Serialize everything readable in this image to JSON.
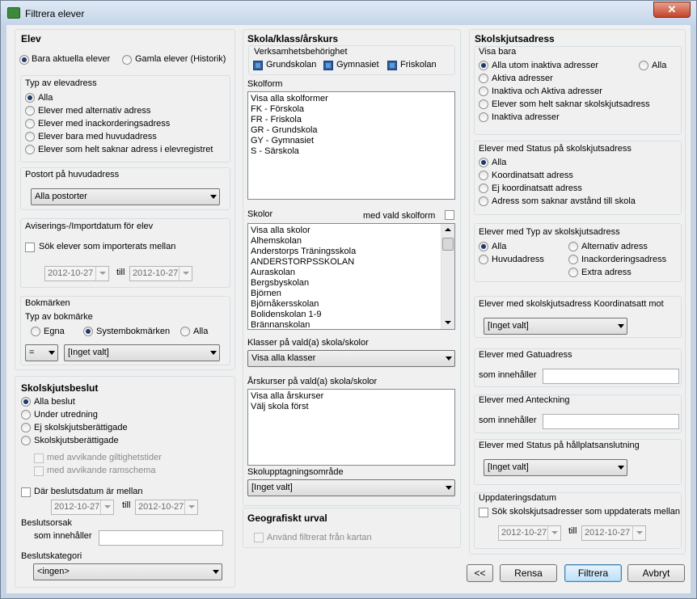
{
  "window": {
    "title": "Filtrera elever",
    "close": "✕"
  },
  "elev": {
    "header": "Elev",
    "r_aktuella": "Bara aktuella elever",
    "r_gamla": "Gamla elever (Historik)",
    "typ_header": "Typ av elevadress",
    "typ": [
      "Alla",
      "Elever med alternativ adress",
      "Elever med inackorderingsadress",
      "Elever bara med huvudadress",
      "Elever som helt saknar adress i elevregistret"
    ],
    "postort_header": "Postort på huvudadress",
    "postort_value": "Alla postorter",
    "avis_header": "Aviserings-/Importdatum för elev",
    "avis_cb": "Sök elever som importerats mellan",
    "date_from": "2012-10-27",
    "till": "till",
    "date_to": "2012-10-27",
    "bok_header": "Bokmärken",
    "bok_typ": "Typ av bokmärke",
    "bok_opts": [
      "Egna",
      "Systembokmärken",
      "Alla"
    ],
    "bok_op": "=",
    "bok_value": "[Inget valt]"
  },
  "beslut": {
    "header": "Skolskjutsbeslut",
    "opts": [
      "Alla beslut",
      "Under utredning",
      "Ej skolskjutsberättigade",
      "Skolskjutsberättigade"
    ],
    "sub1": "med avvikande giltighetstider",
    "sub2": "med avvikande ramschema",
    "date_cb": "Där beslutsdatum är mellan",
    "date_from": "2012-10-27",
    "till": "till",
    "date_to": "2012-10-27",
    "orsak": "Beslutsorsak",
    "innehaller": "som innehåller",
    "kategori": "Beslutskategori",
    "kategori_value": "<ingen>"
  },
  "skola": {
    "header": "Skola/klass/årskurs",
    "verk_header": "Verksamhetsbehörighet",
    "verk": [
      "Grundskolan",
      "Gymnasiet",
      "Friskolan"
    ],
    "skolform_label": "Skolform",
    "skolform": [
      "Visa alla skolformer",
      "FK - Förskola",
      "FR - Friskola",
      "GR - Grundskola",
      "GY - Gymnasiet",
      "S - Särskola"
    ],
    "skolor_label": "Skolor",
    "med_vald": "med vald skolform",
    "skolor": [
      "Visa alla skolor",
      "Alhemskolan",
      "Anderstorps Träningsskola",
      "ANDERSTORPSSKOLAN",
      "Auraskolan",
      "Bergsbyskolan",
      "Björnen",
      "Björnåkersskolan",
      "Bolidenskolan 1-9",
      "Brännanskolan"
    ],
    "klasser_label": "Klasser på vald(a) skola/skolor",
    "klasser_value": "Visa alla klasser",
    "ars_label": "Årskurser på vald(a) skola/skolor",
    "ars": [
      "Visa alla årskurser",
      "Välj skola först"
    ],
    "omrade_label": "Skolupptagningsområde",
    "omrade_value": "[Inget valt]",
    "geo_header": "Geografiskt urval",
    "geo_cb": "Använd filtrerat från kartan"
  },
  "adress": {
    "header": "Skolskjutsadress",
    "visa_header": "Visa bara",
    "visa": [
      "Alla utom inaktiva adresser",
      "Aktiva adresser",
      "Inaktiva och Aktiva adresser",
      "Elever som helt saknar skolskjutsadress",
      "Inaktiva adresser"
    ],
    "visa_alla": "Alla",
    "status_header": "Elever med Status på skolskjutsadress",
    "status": [
      "Alla",
      "Koordinatsatt adress",
      "Ej koordinatsatt adress",
      "Adress som saknar avstånd till skola"
    ],
    "typ_header": "Elever med Typ av skolskjutsadress",
    "typ_left": [
      "Alla",
      "Huvudadress"
    ],
    "typ_right": [
      "Alternativ adress",
      "Inackorderingsadress",
      "Extra adress"
    ],
    "koord_header": "Elever med skolskjutsadress Koordinatsatt mot",
    "koord_value": "[Inget valt]",
    "gatu_header": "Elever med Gatuadress",
    "gatu_label": "som innehåller",
    "ant_header": "Elever med Anteckning",
    "ant_label": "som innehåller",
    "hall_header": "Elever med Status på hållplatsanslutning",
    "hall_value": "[Inget valt]",
    "upd_header": "Uppdateringsdatum",
    "upd_cb": "Sök skolskjutsadresser som uppdaterats mellan",
    "date_from": "2012-10-27",
    "till": "till",
    "date_to": "2012-10-27"
  },
  "buttons": {
    "back": "<<",
    "rensa": "Rensa",
    "filtrera": "Filtrera",
    "avbryt": "Avbryt"
  }
}
